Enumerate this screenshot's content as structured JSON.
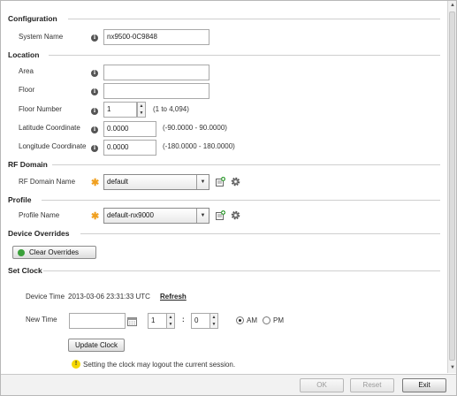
{
  "configuration": {
    "heading": "Configuration",
    "system_name_label": "System Name",
    "system_name_value": "nx9500-0C9848"
  },
  "location": {
    "heading": "Location",
    "area_label": "Area",
    "area_value": "",
    "floor_label": "Floor",
    "floor_value": "",
    "floor_number_label": "Floor Number",
    "floor_number_value": "1",
    "floor_number_range": "(1 to 4,094)",
    "latitude_label": "Latitude Coordinate",
    "latitude_value": "0.0000",
    "latitude_range": "(-90.0000 - 90.0000)",
    "longitude_label": "Longitude Coordinate",
    "longitude_value": "0.0000",
    "longitude_range": "(-180.0000 - 180.0000)"
  },
  "rf_domain": {
    "heading": "RF Domain",
    "name_label": "RF Domain Name",
    "selected": "default"
  },
  "profile": {
    "heading": "Profile",
    "name_label": "Profile Name",
    "selected": "default-nx9000"
  },
  "device_overrides": {
    "heading": "Device Overrides",
    "clear_button": "Clear Overrides"
  },
  "set_clock": {
    "heading": "Set Clock",
    "device_time_label": "Device Time",
    "device_time_value": "2013-03-06 23:31:33 UTC",
    "refresh_link": "Refresh",
    "new_time_label": "New Time",
    "date_value": "",
    "hour_value": "1",
    "colon": ":",
    "minute_value": "0",
    "am_label": "AM",
    "pm_label": "PM",
    "am_selected": true,
    "update_button": "Update Clock",
    "warning_text": "Setting the clock may logout the current session."
  },
  "footer": {
    "ok_label": "OK",
    "reset_label": "Reset",
    "exit_label": "Exit"
  },
  "colors": {
    "required_star": "#f0a020",
    "clear_icon": "#3aa03a",
    "warning_icon": "#f5d800"
  },
  "icons": {
    "info": "info-icon",
    "required": "required-star-icon",
    "new_item": "new-item-icon",
    "configure": "gear-icon",
    "calendar": "calendar-icon",
    "warning": "warning-icon"
  }
}
